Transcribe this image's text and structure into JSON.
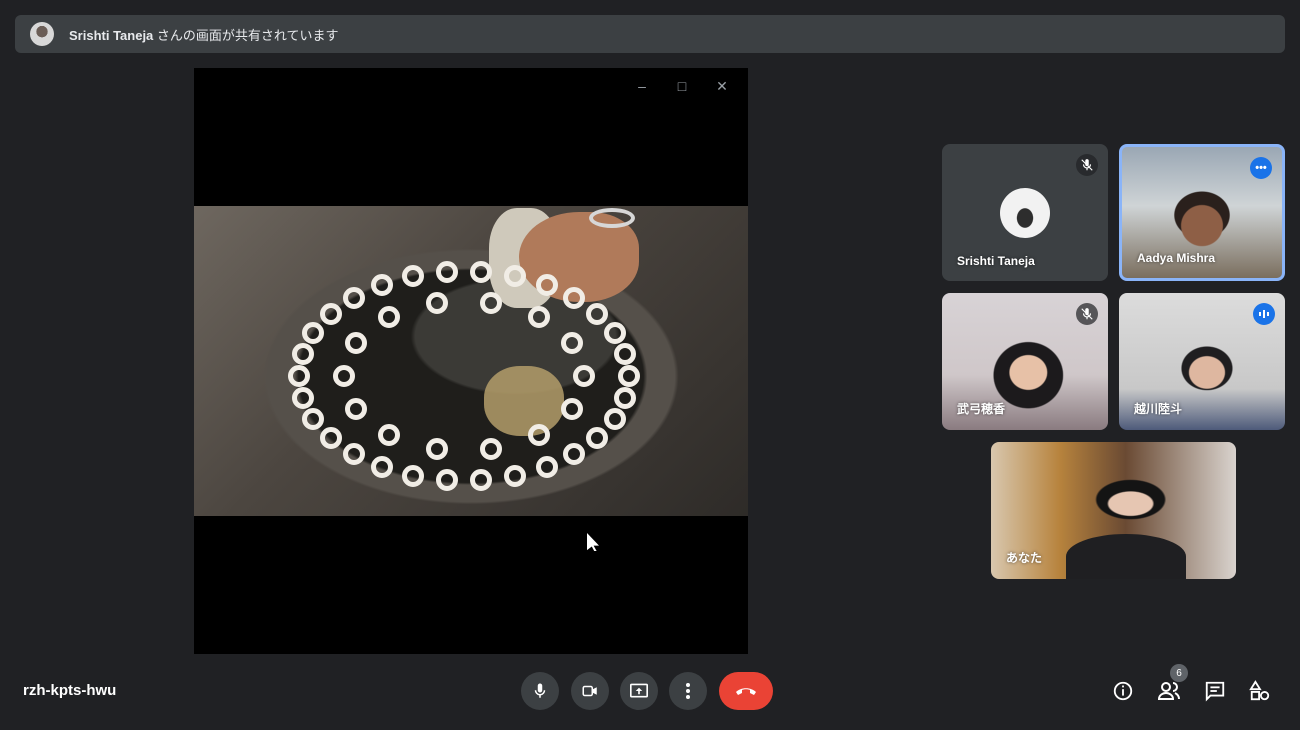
{
  "banner": {
    "presenter_name": "Srishti Taneja",
    "suffix": " さんの画面が共有されています"
  },
  "shared_window": {
    "minimize_label": "–",
    "maximize_label": "□",
    "close_label": "✕"
  },
  "participants": [
    {
      "name": "Srishti Taneja",
      "mic_status": "muted"
    },
    {
      "name": "Aadya Mishra",
      "status": "more-options"
    },
    {
      "name": "武弓穂香",
      "mic_status": "muted"
    },
    {
      "name": "越川陸斗",
      "status": "speaking"
    },
    {
      "name": "あなた"
    }
  ],
  "bottom_bar": {
    "meeting_code": "rzh-kpts-hwu",
    "people_count": "6"
  },
  "colors": {
    "background": "#202124",
    "panel": "#3c4043",
    "accent": "#1a73e8",
    "end_call": "#ea4335",
    "highlight_border": "#8ab4f8"
  }
}
